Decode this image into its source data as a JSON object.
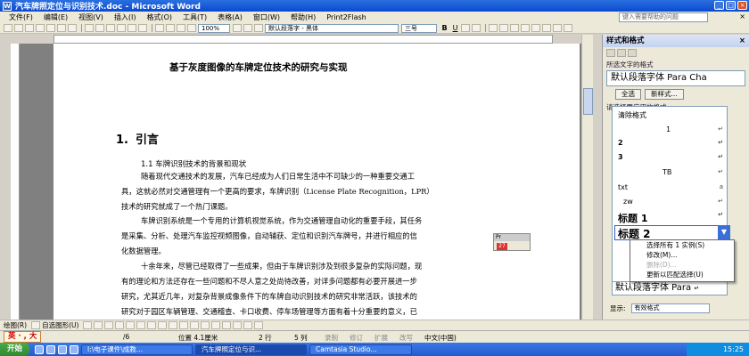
{
  "window": {
    "title": "汽车牌照定位与识别技术.doc - Microsoft Word",
    "app_icon": "W",
    "buttons": {
      "min": "_",
      "max": "□",
      "close": "×"
    }
  },
  "menu": {
    "items": [
      "文件(F)",
      "编辑(E)",
      "视图(V)",
      "插入(I)",
      "格式(O)",
      "工具(T)",
      "表格(A)",
      "窗口(W)",
      "帮助(H)",
      "Print2Flash"
    ],
    "help_placeholder": "键入需要帮助的问题",
    "close_doc": "×"
  },
  "toolbar": {
    "zoom": "100%",
    "style": "默认段落字 - 黑体",
    "size": "三号",
    "bold": "B",
    "underline": "U"
  },
  "document": {
    "title": "基于灰度图像的车牌定位技术的研究与实现",
    "h1_num": "1.",
    "h1_text": "引言",
    "h2": "1.1  车牌识别技术的背景和现状",
    "p1": [
      "随着现代交通技术的发展，汽车已经成为人们日常生活中不可缺少的一种重要交通工",
      "具，这就必然对交通管理有一个更高的要求，车牌识别（License Plate Recognition，LPR）",
      "技术的研究就成了一个热门课题。"
    ],
    "p2": [
      "车牌识别系统是一个专用的计算机视觉系统，作为交通管理自动化的重要手段，其任务",
      "是采集、分析、处理汽车监控视频图像，自动辅获、定位和识别汽车牌号，并进行相应的信",
      "化数据管理。"
    ],
    "p3": [
      "十余年来，尽管已经取得了一些成果，但由于车牌识别涉及到很多复杂的实际问题，现",
      "有的理论和方法还存在一些问题和不尽人意之处尚待改善，对详多问题都有必要开展进一步",
      "研究，尤其近几年，对复杂背景成像条件下的车牌自动识别技术的研究非常活跃，该技术的",
      "研究对于园区车辆管理、交通稽查、卡口收费、停车场管理等方面有着十分重要的意义，已"
    ]
  },
  "floatbox": {
    "label": "Pr",
    "icon": "27"
  },
  "taskpane": {
    "title": "样式和格式",
    "close": "×",
    "selected_label": "所选文字的格式",
    "current": "默认段落字体 Para Cha",
    "select_all_btn": "全选",
    "new_style_btn": "新样式...",
    "apply_label": "请选择要应用的格式",
    "items": [
      {
        "text": "清除格式",
        "mark": ""
      },
      {
        "text": "1",
        "mark": "↵"
      },
      {
        "text": "2",
        "mark": "↵"
      },
      {
        "text": "3",
        "mark": "↵"
      },
      {
        "text": "TB",
        "mark": "↵"
      },
      {
        "text": "txt",
        "mark": "a"
      },
      {
        "text": "zw",
        "mark": "↵"
      },
      {
        "text": "标题 1",
        "mark": "↵"
      },
      {
        "text": "标题 2",
        "mark": "▼"
      }
    ],
    "context_menu": [
      {
        "text": "选择所有 1 实例(S)",
        "disabled": false
      },
      {
        "text": "修改(M)...",
        "disabled": false
      },
      {
        "text": "删除(D)...",
        "disabled": true
      },
      {
        "text": "更新以匹配选择(U)",
        "disabled": false
      }
    ],
    "bottom_item": "默认段落字体 Para",
    "bottom_mark": "↵",
    "show_label": "显示:",
    "show_value": "有效格式"
  },
  "drawbar": {
    "draw": "绘图(R)",
    "autoshape": "自选图形(U)"
  },
  "statusbar": {
    "ime": "英 · , 大",
    "page_frac": "/6",
    "position": "位置 4.1厘米",
    "line": "2 行",
    "col": "5 列",
    "rec": "录制",
    "trk": "修订",
    "ext": "扩展",
    "ovr": "改写",
    "lang": "中文(中国)"
  },
  "taskbar": {
    "start": "开始",
    "tasks": [
      "I:\\电子课件\\成教...",
      "汽车牌照定位与识...",
      "Camtasia Studio..."
    ],
    "clock": "15:25"
  }
}
